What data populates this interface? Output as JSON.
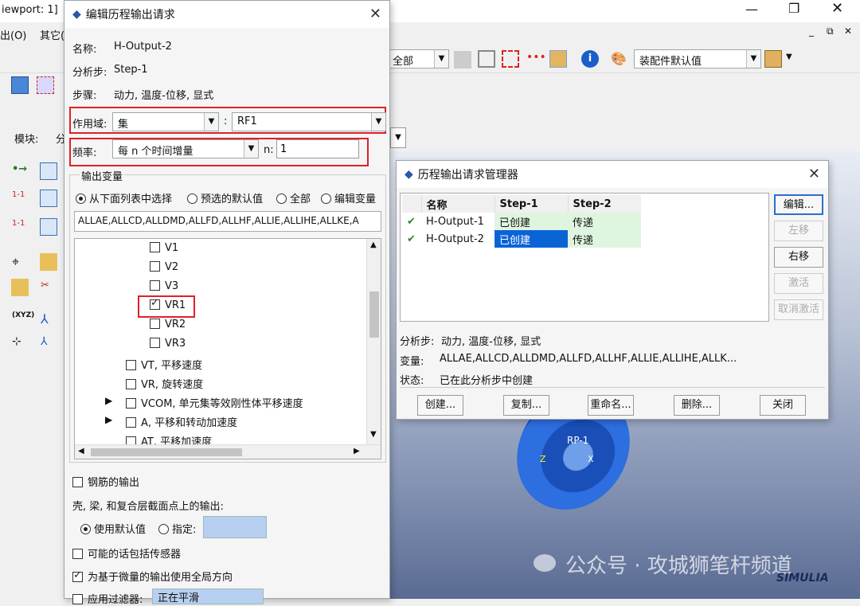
{
  "main": {
    "title_fragment": "iewport: 1]",
    "menu": [
      "出(O)",
      "其它("
    ],
    "toolbar_select_all": "全部",
    "toolbar_select_assembly": "装配件默认值",
    "module_label": "模块:",
    "module_value": "分"
  },
  "edit_dialog": {
    "title": "编辑历程输出请求",
    "name_label": "名称:",
    "name_value": "H-Output-2",
    "step_label": "分析步:",
    "step_value": "Step-1",
    "procedure_label": "步骤:",
    "procedure_value": "动力, 温度-位移, 显式",
    "domain_label": "作用域:",
    "domain_value": "集",
    "domain_sep": ":",
    "domain_set": "RF1",
    "freq_label": "频率:",
    "freq_value": "每 n 个时间增量",
    "n_label": "n:",
    "n_value": "1",
    "output_vars_label": "输出变量",
    "radio_options": [
      "从下面列表中选择",
      "预选的默认值",
      "全部",
      "编辑变量"
    ],
    "vars_text": "ALLAE,ALLCD,ALLDMD,ALLFD,ALLHF,ALLIE,ALLIHE,ALLKE,A",
    "tree_items": [
      {
        "label": "V1",
        "checked": false,
        "indent": 2,
        "expander": false
      },
      {
        "label": "V2",
        "checked": false,
        "indent": 2,
        "expander": false
      },
      {
        "label": "V3",
        "checked": false,
        "indent": 2,
        "expander": false
      },
      {
        "label": "VR1",
        "checked": true,
        "indent": 2,
        "expander": false
      },
      {
        "label": "VR2",
        "checked": false,
        "indent": 2,
        "expander": false
      },
      {
        "label": "VR3",
        "checked": false,
        "indent": 2,
        "expander": false
      },
      {
        "label": "VT, 平移速度",
        "checked": false,
        "indent": 1,
        "expander": false
      },
      {
        "label": "VR, 旋转速度",
        "checked": false,
        "indent": 1,
        "expander": false
      },
      {
        "label": "VCOM, 单元集等效刚性体平移速度",
        "checked": false,
        "indent": 1,
        "expander": true
      },
      {
        "label": "A, 平移和转动加速度",
        "checked": false,
        "indent": 1,
        "expander": true
      },
      {
        "label": "AT, 平移加速度",
        "checked": false,
        "indent": 1,
        "expander": false
      }
    ],
    "rebar_label": "钢筋的输出",
    "shell_label": "壳, 梁, 和复合层截面点上的输出:",
    "use_default_label": "使用默认值",
    "specify_label": "指定:",
    "sensor_label": "可能的话包括传感器",
    "global_dir_label": "为基于微量的输出使用全局方向",
    "filter_label": "应用过滤器:",
    "filter_value": "正在平滑"
  },
  "manager_dialog": {
    "title": "历程输出请求管理器",
    "headers": [
      "名称",
      "Step-1",
      "Step-2"
    ],
    "rows": [
      {
        "check": "✔",
        "name": "H-Output-1",
        "s1": "已创建",
        "s2": "传递"
      },
      {
        "check": "✔",
        "name": "H-Output-2",
        "s1": "已创建",
        "s2": "传递"
      }
    ],
    "side_buttons": [
      "编辑...",
      "左移",
      "右移",
      "激活",
      "取消激活"
    ],
    "step_info_label": "分析步:",
    "step_info_value": "动力, 温度-位移, 显式",
    "var_label": "变量:",
    "var_value": "ALLAE,ALLCD,ALLDMD,ALLFD,ALLHF,ALLIE,ALLIHE,ALLK...",
    "state_label": "状态:",
    "state_value": "已在此分析步中创建",
    "bottom_buttons": [
      "创建...",
      "复制...",
      "重命名...",
      "删除...",
      "关闭"
    ]
  },
  "viewport": {
    "rp_label": "RP-1",
    "axis_x": "X",
    "axis_z": "Z",
    "watermark": "公众号 · 攻城狮笔杆频道",
    "brand": "SIMULIA"
  },
  "colors": {
    "selection": "#0a64d6",
    "row_green": "#dff5df",
    "highlight_red": "#e0202a",
    "part_blue": "#1f5fd6"
  }
}
